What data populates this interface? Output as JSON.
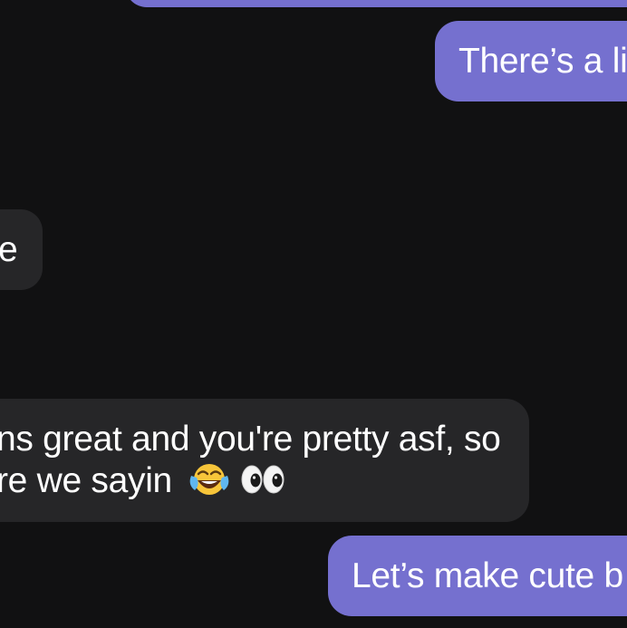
{
  "messages": [
    {
      "id": "m0",
      "direction": "sent",
      "text": ""
    },
    {
      "id": "m1",
      "direction": "sent",
      "text": "There’s a li"
    },
    {
      "id": "m2",
      "direction": "received",
      "text": "e"
    },
    {
      "id": "m3",
      "direction": "received",
      "lines": [
        "ns great and you're pretty asf, so",
        "re we sayin"
      ],
      "emojis": [
        "face-with-tears-of-joy-icon",
        "eyes-icon"
      ]
    },
    {
      "id": "m4",
      "direction": "sent",
      "text": "Let’s make cute b"
    }
  ],
  "colors": {
    "background": "#111112",
    "sent_bubble": "#7570cf",
    "received_bubble": "#262628",
    "text": "#ffffff"
  }
}
